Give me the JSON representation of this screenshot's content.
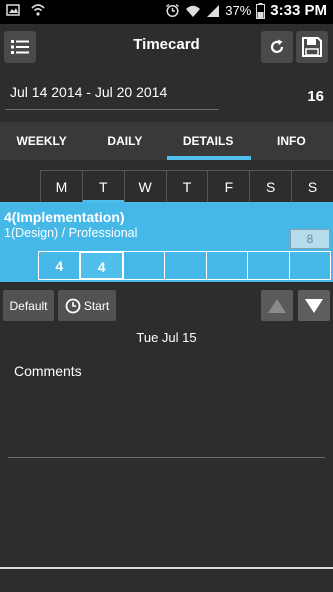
{
  "statusbar": {
    "battery_pct": "37%",
    "time": "3:33 PM"
  },
  "actionbar": {
    "title": "Timecard"
  },
  "period": {
    "range": "Jul 14 2014 - Jul 20 2014",
    "total_hours": "16"
  },
  "tabs": [
    {
      "label": "WEEKLY"
    },
    {
      "label": "DAILY"
    },
    {
      "label": "DETAILS"
    },
    {
      "label": "INFO"
    }
  ],
  "days": [
    "M",
    "T",
    "W",
    "T",
    "F",
    "S",
    "S"
  ],
  "project": {
    "title": "4(Implementation)",
    "subtitle": "1(Design) / Professional",
    "total": "8",
    "hours": [
      "4",
      "4",
      "",
      "",
      "",
      "",
      ""
    ]
  },
  "controls": {
    "default_label": "Default",
    "start_label": "Start"
  },
  "selected_date": "Tue Jul 15",
  "comments_label": "Comments",
  "colors": {
    "accent": "#4fc0ec",
    "panel": "#46b8e8",
    "background": "#2d2d2d"
  }
}
